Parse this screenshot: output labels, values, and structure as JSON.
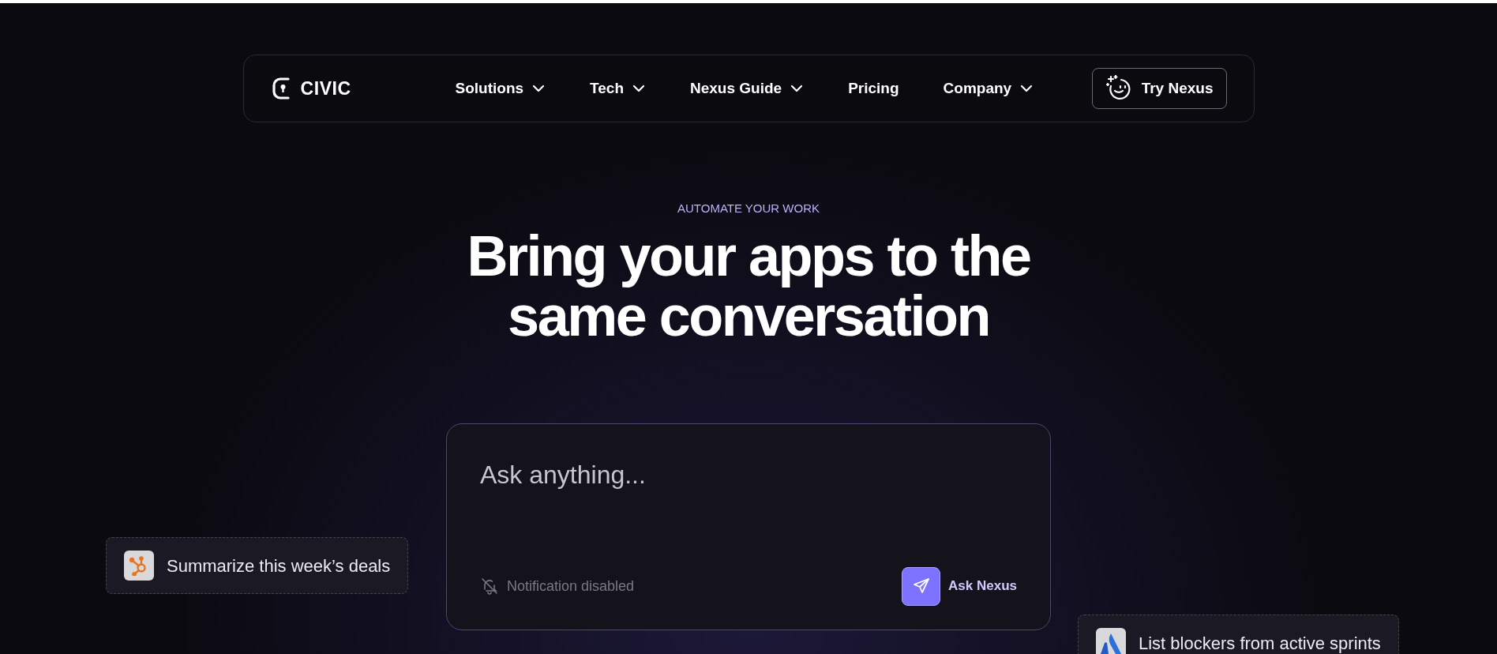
{
  "nav": {
    "logo": "CIVIC",
    "items": [
      {
        "label": "Solutions",
        "dropdown": true
      },
      {
        "label": "Tech",
        "dropdown": true
      },
      {
        "label": "Nexus Guide",
        "dropdown": true
      },
      {
        "label": "Pricing",
        "dropdown": false
      },
      {
        "label": "Company",
        "dropdown": true
      }
    ],
    "cta": "Try Nexus"
  },
  "hero": {
    "eyebrow": "AUTOMATE YOUR WORK",
    "title_lines": [
      "Bring your apps to the",
      "same conversation"
    ]
  },
  "chat": {
    "placeholder": "Ask anything...",
    "notification": "Notification disabled",
    "submit": "Ask Nexus"
  },
  "chips": [
    {
      "kind": "hubspot",
      "label": "Summarize this week’s deals"
    },
    {
      "kind": "atlassian",
      "label": "List blockers from active sprints"
    }
  ]
}
